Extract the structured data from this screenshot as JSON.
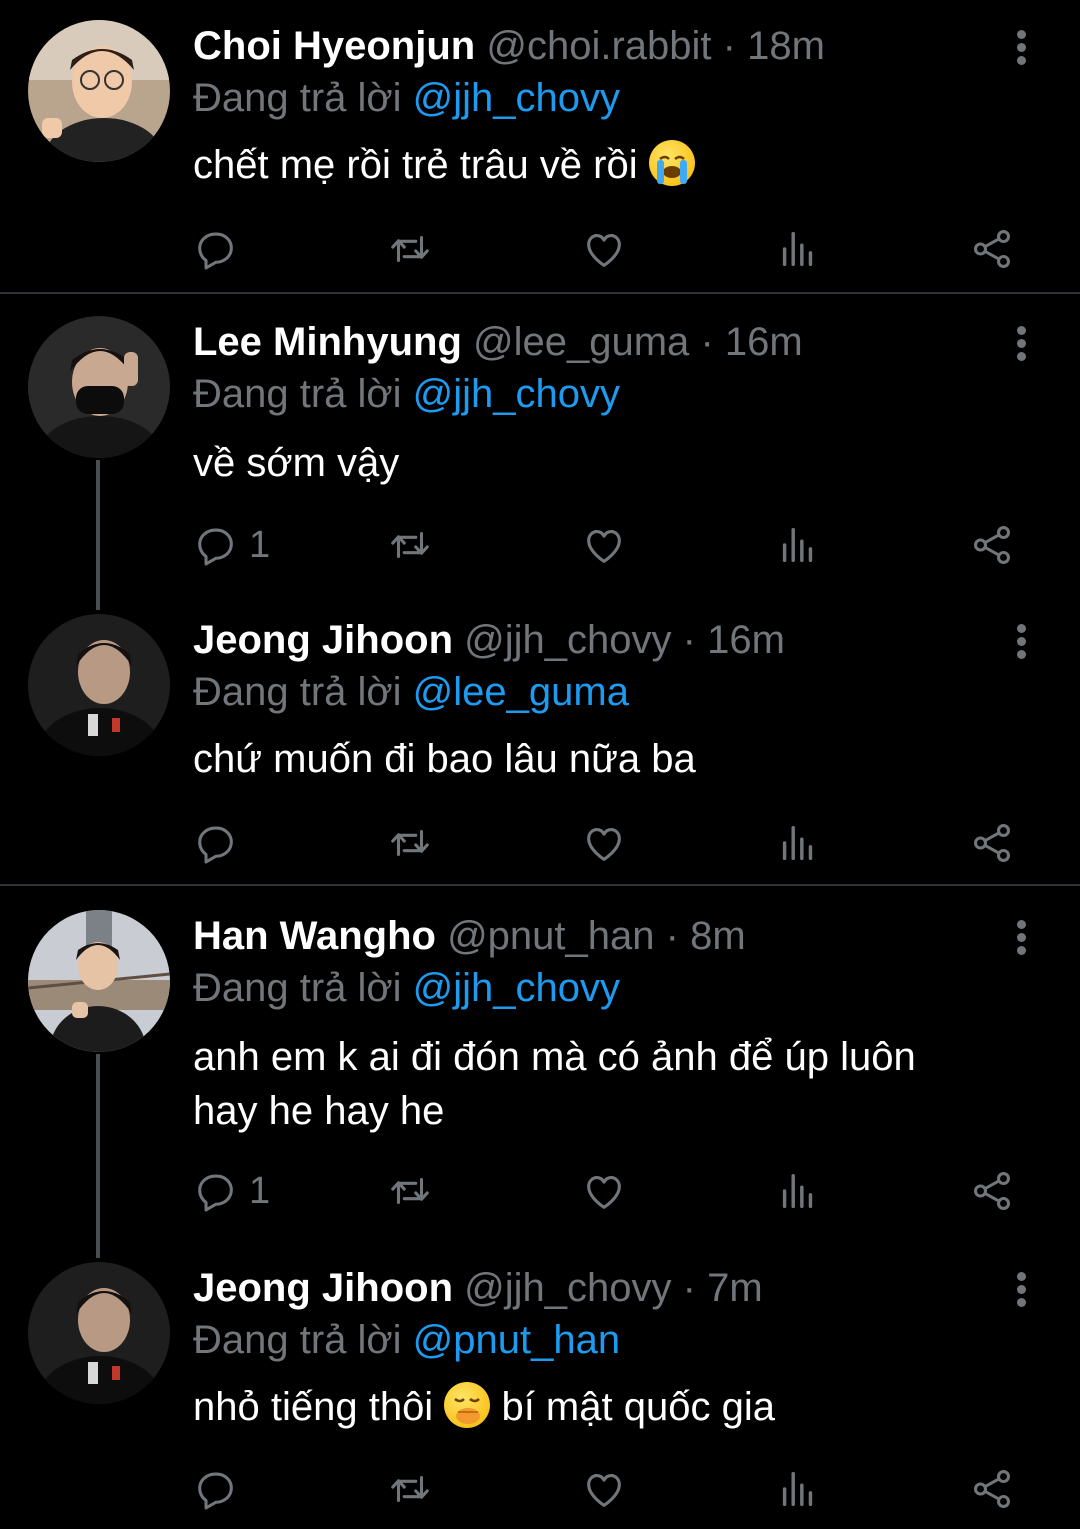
{
  "colors": {
    "background": "#000000",
    "name": "#ffffff",
    "muted": "#71767b",
    "mention": "#1d9bf0",
    "divider": "#2f3336"
  },
  "tweets": [
    {
      "name": "Choi Hyeonjun",
      "handle": "@choi.rabbit",
      "dot": "·",
      "time": "18m",
      "replying_prefix": "Đang trả lời",
      "replying_to": "@jjh_chovy",
      "text_before": "chết mẹ rồi trẻ trâu về rồi",
      "emoji": "loudly-crying-face",
      "reply_count": "",
      "avatar": "avatar-choi-hyeonjun"
    },
    {
      "name": "Lee Minhyung",
      "handle": "@lee_guma",
      "dot": "·",
      "time": "16m",
      "replying_prefix": "Đang trả lời",
      "replying_to": "@jjh_chovy",
      "text_before": "về sớm vậy",
      "reply_count": "1",
      "avatar": "avatar-lee-minhyung"
    },
    {
      "name": "Jeong Jihoon",
      "handle": "@jjh_chovy",
      "dot": "·",
      "time": "16m",
      "replying_prefix": "Đang trả lời",
      "replying_to": "@lee_guma",
      "text_before": "chứ muốn đi bao lâu nữa ba",
      "reply_count": "",
      "avatar": "avatar-jeong-jihoon"
    },
    {
      "name": "Han Wangho",
      "handle": "@pnut_han",
      "dot": "·",
      "time": "8m",
      "replying_prefix": "Đang trả lời",
      "replying_to": "@jjh_chovy",
      "text_line1": "anh em k ai đi đón mà có ảnh để úp luôn",
      "text_line2": "hay he hay he",
      "reply_count": "1",
      "avatar": "avatar-han-wangho"
    },
    {
      "name": "Jeong Jihoon",
      "handle": "@jjh_chovy",
      "dot": "·",
      "time": "7m",
      "replying_prefix": "Đang trả lời",
      "replying_to": "@pnut_han",
      "text_before": "nhỏ tiếng thôi",
      "emoji": "face-with-hand-over-mouth",
      "text_after": "bí mật quốc gia",
      "reply_count": "",
      "avatar": "avatar-jeong-jihoon"
    }
  ],
  "icons": [
    "reply-icon",
    "retweet-icon",
    "like-icon",
    "views-icon",
    "share-icon",
    "more-icon"
  ]
}
